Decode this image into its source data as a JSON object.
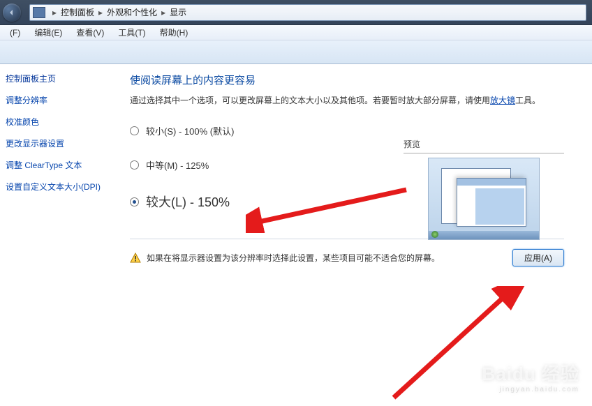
{
  "breadcrumb": {
    "items": [
      "控制面板",
      "外观和个性化",
      "显示"
    ]
  },
  "menubar": {
    "file": "(F)",
    "edit": "编辑(E)",
    "view": "查看(V)",
    "tools": "工具(T)",
    "help": "帮助(H)"
  },
  "sidebar": {
    "home": "控制面板主页",
    "links": [
      "调整分辨率",
      "校准颜色",
      "更改显示器设置",
      "调整 ClearType 文本",
      "设置自定义文本大小(DPI)"
    ]
  },
  "main": {
    "subtitle": "使阅读屏幕上的内容更容易",
    "desc_pre": "通过选择其中一个选项，可以更改屏幕上的文本大小以及其他项。若要暂时放大部分屏幕，请使用",
    "desc_link": "放大镜",
    "desc_post": "工具。",
    "preview_label": "预览",
    "options": {
      "small": "较小(S) - 100% (默认)",
      "medium": "中等(M) - 125%",
      "large": "较大(L) - 150%"
    },
    "warning": "如果在将显示器设置为该分辨率时选择此设置，某些项目可能不适合您的屏幕。",
    "apply": "应用(A)"
  },
  "watermark": {
    "brand": "Baidu 经验",
    "url": "jingyan.baidu.com"
  }
}
